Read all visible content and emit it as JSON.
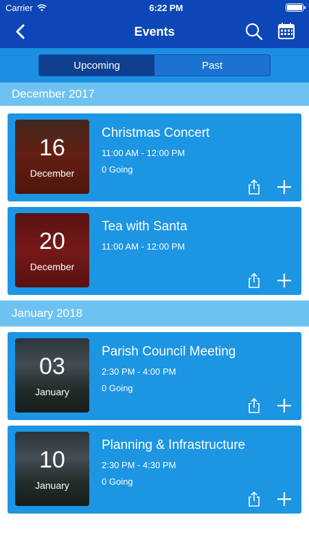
{
  "status_bar": {
    "carrier": "Carrier",
    "time": "6:22 PM"
  },
  "nav": {
    "title": "Events"
  },
  "segments": [
    {
      "label": "Upcoming",
      "active": true
    },
    {
      "label": "Past",
      "active": false
    }
  ],
  "sections": [
    {
      "header": "December 2017",
      "events": [
        {
          "day": "16",
          "month": "December",
          "title": "Christmas Concert",
          "time": "11:00 AM - 12:00 PM",
          "going": "0 Going"
        },
        {
          "day": "20",
          "month": "December",
          "title": "Tea with Santa",
          "time": "11:00 AM - 12:00 PM",
          "going": ""
        }
      ]
    },
    {
      "header": "January 2018",
      "events": [
        {
          "day": "03",
          "month": "January",
          "title": "Parish Council Meeting",
          "time": "2:30 PM - 4:00 PM",
          "going": "0 Going"
        },
        {
          "day": "10",
          "month": "January",
          "title": "Planning & Infrastructure",
          "time": "2:30 PM - 4:30 PM",
          "going": "0 Going"
        }
      ]
    }
  ],
  "colors": {
    "nav": "#0d47b7",
    "accent": "#1c95e3",
    "section": "#6ec2f2"
  }
}
